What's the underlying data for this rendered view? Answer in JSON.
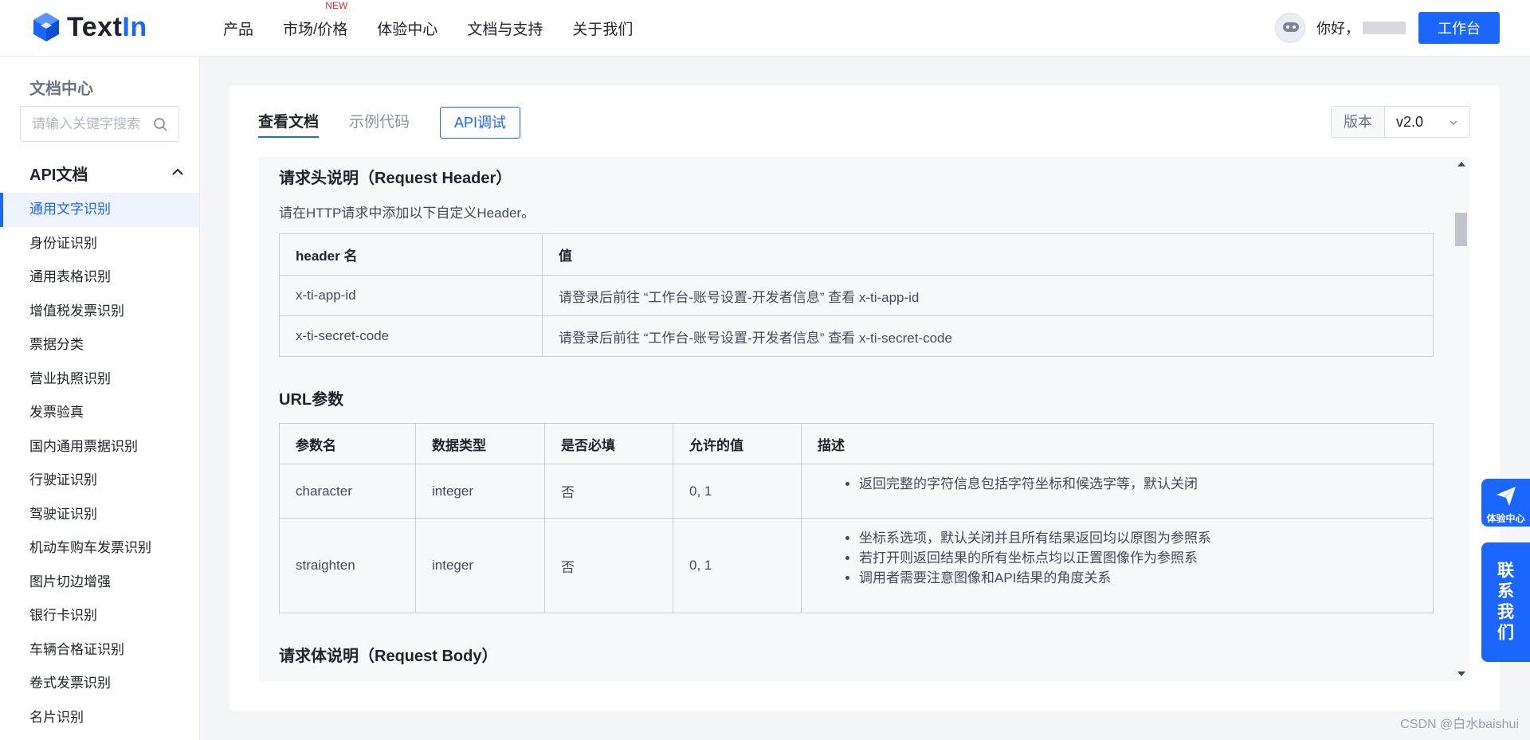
{
  "header": {
    "logo_text_a": "Text",
    "logo_text_b": "In",
    "nav": [
      {
        "label": "产品"
      },
      {
        "label": "市场/价格",
        "badge": "NEW"
      },
      {
        "label": "体验中心"
      },
      {
        "label": "文档与支持"
      },
      {
        "label": "关于我们"
      }
    ],
    "greeting": "你好，",
    "workbench_label": "工作台"
  },
  "sidebar": {
    "title": "文档中心",
    "search_placeholder": "请输入关键字搜索",
    "group_title": "API文档",
    "items": [
      {
        "label": "通用文字识别",
        "active": true
      },
      {
        "label": "身份证识别"
      },
      {
        "label": "通用表格识别"
      },
      {
        "label": "增值税发票识别"
      },
      {
        "label": "票据分类"
      },
      {
        "label": "营业执照识别"
      },
      {
        "label": "发票验真"
      },
      {
        "label": "国内通用票据识别"
      },
      {
        "label": "行驶证识别"
      },
      {
        "label": "驾驶证识别"
      },
      {
        "label": "机动车购车发票识别"
      },
      {
        "label": "图片切边增强"
      },
      {
        "label": "银行卡识别"
      },
      {
        "label": "车辆合格证识别"
      },
      {
        "label": "卷式发票识别"
      },
      {
        "label": "名片识别"
      }
    ]
  },
  "main": {
    "tabs": [
      {
        "label": "查看文档",
        "active": true
      },
      {
        "label": "示例代码"
      }
    ],
    "api_test_button": "API调试",
    "version_label": "版本",
    "version_value": "v2.0",
    "section_header_title": "请求头说明（Request Header）",
    "section_header_desc": "请在HTTP请求中添加以下自定义Header。",
    "header_table": {
      "columns": [
        "header 名",
        "值"
      ],
      "rows": [
        [
          "x-ti-app-id",
          "请登录后前往 “工作台-账号设置-开发者信息” 查看 x-ti-app-id"
        ],
        [
          "x-ti-secret-code",
          "请登录后前往 “工作台-账号设置-开发者信息” 查看 x-ti-secret-code"
        ]
      ]
    },
    "section_url_title": "URL参数",
    "url_table": {
      "columns": [
        "参数名",
        "数据类型",
        "是否必填",
        "允许的值",
        "描述"
      ],
      "rows": [
        {
          "name": "character",
          "type": "integer",
          "required": "否",
          "allowed": "0, 1",
          "desc": [
            "返回完整的字符信息包括字符坐标和候选字等，默认关闭"
          ]
        },
        {
          "name": "straighten",
          "type": "integer",
          "required": "否",
          "allowed": "0, 1",
          "desc": [
            "坐标系选项，默认关闭并且所有结果返回均以原图为参照系",
            "若打开则返回结果的所有坐标点均以正置图像作为参照系",
            "调用者需要注意图像和API结果的角度关系"
          ]
        }
      ]
    },
    "section_body_title": "请求体说明（Request Body）"
  },
  "float": {
    "experience_label": "体验中心",
    "contact_label": "联系我们"
  },
  "watermark": "CSDN @白水baishui",
  "colors": {
    "accent": "#1a66ff",
    "badge": "#f5222d"
  }
}
